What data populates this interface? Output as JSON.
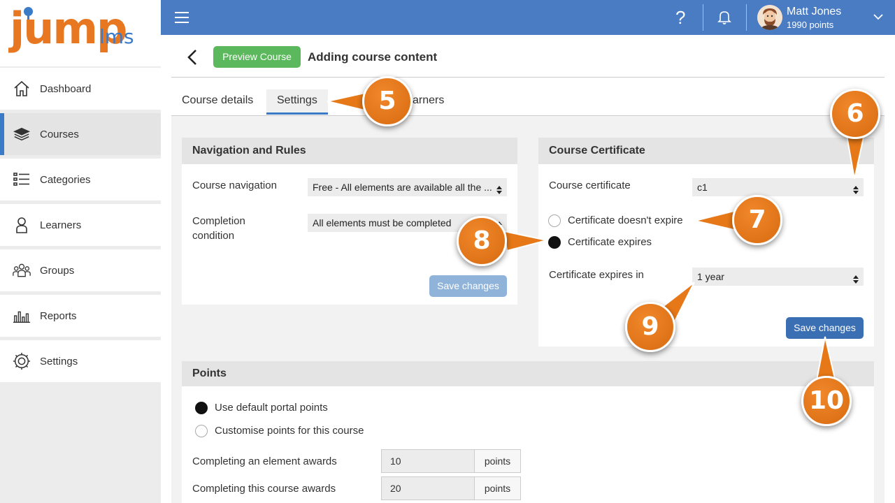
{
  "brand": {
    "logo_main": "jump",
    "logo_suffix": "lms"
  },
  "sidebar": {
    "items": [
      {
        "label": "Dashboard",
        "icon": "home-icon",
        "active": false
      },
      {
        "label": "Courses",
        "icon": "books-icon",
        "active": true
      },
      {
        "label": "Categories",
        "icon": "list-icon",
        "active": false
      },
      {
        "label": "Learners",
        "icon": "person-icon",
        "active": false
      },
      {
        "label": "Groups",
        "icon": "group-icon",
        "active": false
      },
      {
        "label": "Reports",
        "icon": "bar-chart-icon",
        "active": false
      },
      {
        "label": "Settings",
        "icon": "gear-icon",
        "active": false
      }
    ]
  },
  "topbar": {
    "help_glyph": "?",
    "user_name": "Matt Jones",
    "user_points": "1990 points",
    "colors": {
      "bar": "#4a7cc4"
    }
  },
  "header": {
    "preview_label": "Preview Course",
    "title": "Adding course content"
  },
  "tabs": [
    {
      "label": "Course details",
      "active": false
    },
    {
      "label": "Settings",
      "active": true
    },
    {
      "label": "arners",
      "active": false
    }
  ],
  "navigation_panel": {
    "title": "Navigation and Rules",
    "course_navigation_label": "Course navigation",
    "course_navigation_value": "Free - All elements are available all the ...",
    "completion_label_1": "Completion",
    "completion_label_2": "condition",
    "completion_value": "All elements must be completed",
    "save_label": "Save changes"
  },
  "certificate_panel": {
    "title": "Course Certificate",
    "certificate_label": "Course certificate",
    "certificate_value": "c1",
    "radio_no_expire": "Certificate doesn't expire",
    "radio_expires": "Certificate expires",
    "selected": "expires",
    "expires_in_label": "Certificate expires in",
    "expires_in_value": "1 year",
    "save_label": "Save changes"
  },
  "points_panel": {
    "title": "Points",
    "radio_default": "Use default portal points",
    "radio_custom": "Customise points for this course",
    "selected": "default",
    "element_label": "Completing an element awards",
    "element_value": "10",
    "course_label": "Completing this course awards",
    "course_value": "20",
    "unit": "points"
  },
  "callouts": [
    "5",
    "6",
    "7",
    "8",
    "9",
    "10"
  ],
  "colors": {
    "accent": "#3a7bc8",
    "preview_green": "#5cb85c",
    "save_enabled": "#3a6fb4",
    "save_disabled": "#8fb3d9",
    "callout_orange": "#e67817"
  }
}
